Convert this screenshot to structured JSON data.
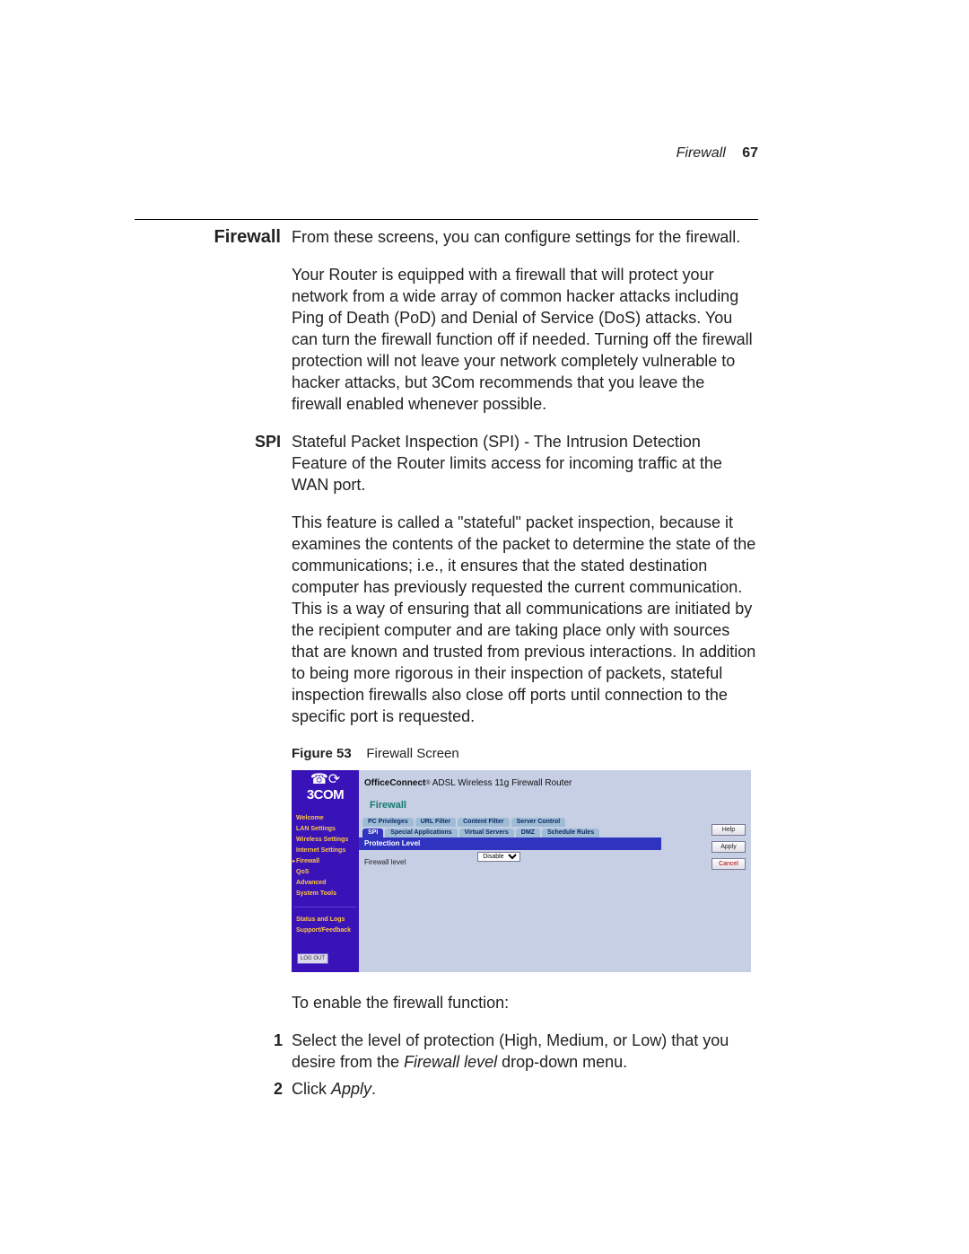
{
  "header": {
    "chapter": "Firewall",
    "page_no": "67"
  },
  "sections": {
    "firewall_heading": "Firewall",
    "firewall_intro": "From these screens, you can configure settings for the firewall.",
    "firewall_body": "Your Router is equipped with a firewall that will protect your network from a wide array of common hacker attacks including Ping of Death (PoD) and Denial of Service (DoS) attacks. You can turn the firewall function off if needed. Turning off the firewall protection will not leave your network completely vulnerable to hacker attacks, but 3Com recommends that you leave the firewall enabled whenever possible.",
    "spi_heading": "SPI",
    "spi_p1": "Stateful Packet Inspection (SPI) - The Intrusion Detection Feature of the Router limits access for incoming traffic at the WAN port.",
    "spi_p2": "This feature is called a \"stateful\" packet inspection, because it examines the contents of the packet to determine the state of the communications; i.e., it ensures that the stated destination computer has previously requested the current communication. This is a way of ensuring that all communications are initiated by the recipient computer and are taking place only with sources that are known and trusted from previous interactions. In addition to being more rigorous in their inspection of packets, stateful inspection firewalls also close off ports until connection to the specific port is requested."
  },
  "figure": {
    "label": "Figure 53",
    "caption": "Firewall Screen"
  },
  "screenshot": {
    "logo_text": "3COM",
    "product_brand": "OfficeConnect",
    "product_model": "ADSL Wireless 11g Firewall Router",
    "section_title": "Firewall",
    "nav": [
      "Welcome",
      "LAN Settings",
      "Wireless Settings",
      "Internet Settings",
      "Firewall",
      "QoS",
      "Advanced",
      "System Tools"
    ],
    "nav2": [
      "Status and Logs",
      "Support/Feedback"
    ],
    "nav_selected_index": 4,
    "logout": "LOG OUT",
    "tabs_row1": [
      "PC Privileges",
      "URL Filter",
      "Content Filter",
      "Server Control"
    ],
    "tabs_row2": [
      "SPI",
      "Special Applications",
      "Virtual Servers",
      "DMZ",
      "Schedule Rules"
    ],
    "tabs_row2_active_index": 0,
    "panel_head": "Protection Level",
    "field_label": "Firewall level",
    "field_value": "Disable",
    "buttons": {
      "help": "Help",
      "apply": "Apply",
      "cancel": "Cancel"
    }
  },
  "post_figure": {
    "lead": "To enable the firewall function:",
    "step1_pre": "Select the level of protection (High, Medium, or Low) that you desire from the ",
    "step1_em": "Firewall level",
    "step1_post": " drop-down menu.",
    "step2_pre": "Click ",
    "step2_em": "Apply",
    "step2_post": "."
  }
}
